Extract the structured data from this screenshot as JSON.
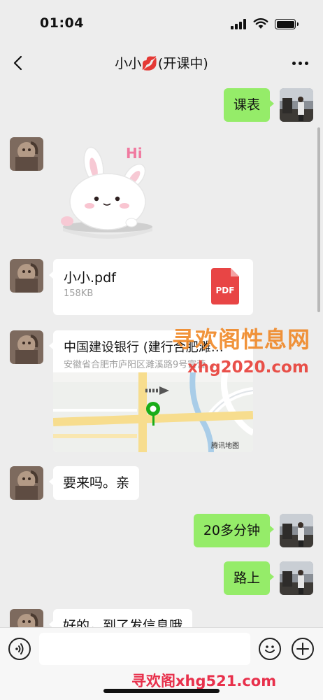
{
  "status_bar": {
    "time": "01:04"
  },
  "nav": {
    "title": "小小",
    "title_emoji": "💋",
    "title_suffix": "(开课中)"
  },
  "messages": [
    {
      "from": "me",
      "type": "text",
      "text": "课表"
    },
    {
      "from": "other",
      "type": "sticker",
      "sticker_text": "Hi"
    },
    {
      "from": "other",
      "type": "file",
      "name": "小小.pdf",
      "size": "158KB",
      "icon_label": "PDF"
    },
    {
      "from": "other",
      "type": "location",
      "title": "中国建设银行 (建行合肥濉…",
      "address": "安徽省合肥市庐阳区濉溪路9号富营…",
      "map_provider": "腾讯地图"
    },
    {
      "from": "other",
      "type": "text",
      "text": "要来吗。亲"
    },
    {
      "from": "me",
      "type": "text",
      "text": "20多分钟"
    },
    {
      "from": "me",
      "type": "text",
      "text": "路上"
    },
    {
      "from": "other",
      "type": "text",
      "text": "好的，到了发信息哦"
    }
  ],
  "watermarks": {
    "site_name": "寻欢阁性息网",
    "site_url": "xhg2020.com",
    "bottom": "寻欢阁xhg521.com"
  },
  "input_bar": {
    "placeholder": ""
  },
  "colors": {
    "my_bubble": "#95ec69",
    "other_bubble": "#ffffff",
    "background": "#ededed"
  }
}
